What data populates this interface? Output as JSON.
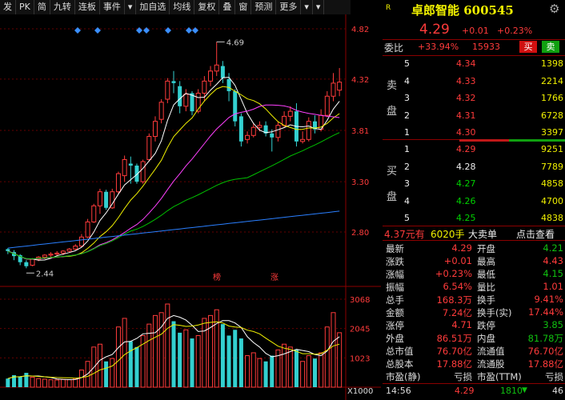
{
  "toolbar": {
    "items": [
      "发",
      "PK",
      "简",
      "九转",
      "连板",
      "事件",
      "▾",
      "加自选",
      "均线",
      "复权",
      "叠",
      "窗",
      "预测",
      "更多",
      "▾",
      "▾"
    ]
  },
  "chart": {
    "price_ticks": [
      "4.82",
      "4.32",
      "3.81",
      "3.30",
      "2.80"
    ],
    "vol_ticks": [
      "3068",
      "2045",
      "1023"
    ],
    "vol_unit": "X1000",
    "high_label": "4.69",
    "low_label": "2.44",
    "marker1": "榜",
    "marker2": "涨"
  },
  "quote": {
    "logo": "R",
    "name": "卓郎智能 600545",
    "price": "4.29",
    "change": "+0.01",
    "change_pct": "+0.23%",
    "webi_label": "委比",
    "webi_pct": "+33.94%",
    "webi_vol": "15933",
    "sell_btn": "买",
    "buy_btn": "卖",
    "sell_label": "卖盘",
    "buy_label": "买盘",
    "asks": [
      {
        "lvl": "5",
        "price": "4.34",
        "vol": "1398"
      },
      {
        "lvl": "4",
        "price": "4.33",
        "vol": "2214"
      },
      {
        "lvl": "3",
        "price": "4.32",
        "vol": "1766"
      },
      {
        "lvl": "2",
        "price": "4.31",
        "vol": "6728"
      },
      {
        "lvl": "1",
        "price": "4.30",
        "vol": "3397"
      }
    ],
    "bids": [
      {
        "lvl": "1",
        "price": "4.29",
        "vol": "9251"
      },
      {
        "lvl": "2",
        "price": "4.28",
        "vol": "7789"
      },
      {
        "lvl": "3",
        "price": "4.27",
        "vol": "4858"
      },
      {
        "lvl": "4",
        "price": "4.26",
        "vol": "4700"
      },
      {
        "lvl": "5",
        "price": "4.25",
        "vol": "4838"
      }
    ],
    "big_order": {
      "price": "4.37元有",
      "vol": "6020手",
      "label": "大卖单",
      "link": "点击查看"
    },
    "stats": [
      {
        "l1": "最新",
        "v1": "4.29",
        "l2": "开盘",
        "v2": "4.21"
      },
      {
        "l1": "涨跌",
        "v1": "+0.01",
        "l2": "最高",
        "v2": "4.43"
      },
      {
        "l1": "涨幅",
        "v1": "+0.23%",
        "l2": "最低",
        "v2": "4.15"
      },
      {
        "l1": "振幅",
        "v1": "6.54%",
        "l2": "量比",
        "v2": "1.01"
      },
      {
        "l1": "总手",
        "v1": "168.3万",
        "l2": "换手",
        "v2": "9.41%"
      },
      {
        "l1": "金额",
        "v1": "7.24亿",
        "l2": "换手(实)",
        "v2": "17.44%"
      },
      {
        "l1": "涨停",
        "v1": "4.71",
        "l2": "跌停",
        "v2": "3.85"
      },
      {
        "l1": "外盘",
        "v1": "86.51万",
        "l2": "内盘",
        "v2": "81.78万"
      },
      {
        "l1": "总市值",
        "v1": "76.70亿",
        "l2": "流通值",
        "v2": "76.70亿"
      },
      {
        "l1": "总股本",
        "v1": "17.88亿",
        "l2": "流通股",
        "v2": "17.88亿"
      },
      {
        "l1": "市盈(静)",
        "v1": "亏损",
        "l2": "市盈(TTM)",
        "v2": "亏损"
      }
    ],
    "tick": {
      "time": "14:56",
      "price": "4.29",
      "vol": "1810",
      "count": "46"
    }
  }
}
